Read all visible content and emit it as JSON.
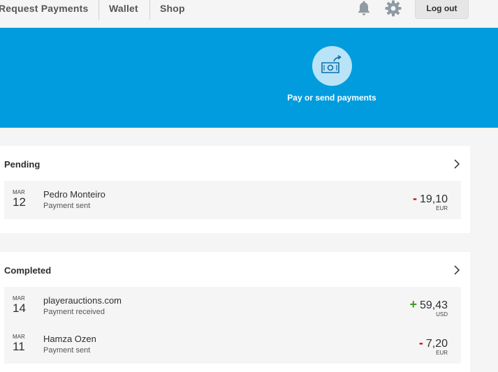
{
  "nav": {
    "links": [
      "Request Payments",
      "Wallet",
      "Shop"
    ],
    "logout_label": "Log out",
    "icons": [
      "bell-icon",
      "gear-icon"
    ]
  },
  "hero": {
    "action_label": "Pay or send payments",
    "icon": "send-money-icon",
    "color": "#009cde"
  },
  "pending": {
    "title": "Pending",
    "items": [
      {
        "month": "MAR",
        "day": "12",
        "name": "Pedro Monteiro",
        "status": "Payment sent",
        "sign": "-",
        "amount": "19,10",
        "currency": "EUR"
      }
    ]
  },
  "completed": {
    "title": "Completed",
    "items": [
      {
        "month": "MAR",
        "day": "14",
        "name": "playerauctions.com",
        "status": "Payment received",
        "sign": "+",
        "amount": "59,43",
        "currency": "USD"
      },
      {
        "month": "MAR",
        "day": "11",
        "name": "Hamza Ozen",
        "status": "Payment sent",
        "sign": "-",
        "amount": "7,20",
        "currency": "EUR"
      }
    ]
  },
  "colors": {
    "negative": "#d20000",
    "positive": "#3a9b23"
  }
}
